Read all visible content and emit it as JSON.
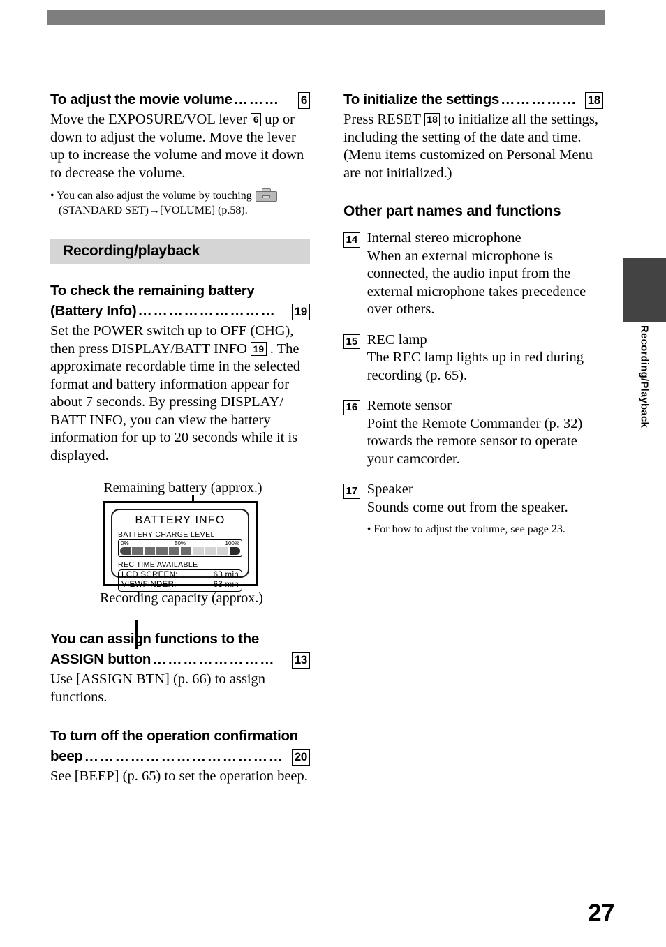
{
  "page": {
    "number": "27",
    "side_tab_label": "Recording/Playback",
    "accent_band_color": "#7e7e7e",
    "side_tab_color": "#434343",
    "section_band_color": "#d5d5d5"
  },
  "left_column": {
    "movie_volume": {
      "heading_text": "To adjust the movie volume",
      "heading_dots": "………",
      "heading_ref": "6",
      "body_line_1": "Move the EXPOSURE/VOL lever",
      "body_ref": "6",
      "body_line_2": "up or down to adjust the volume. Move the lever up to increase the volume and move it down to decrease the volume.",
      "bullet_prefix": "• You can also adjust the volume by touching",
      "bullet_icon": "setup-toolbox-icon",
      "bullet_suffix": "(STANDARD SET)→[VOLUME] (p.58)."
    },
    "section_band": "Recording/playback",
    "battery_check": {
      "heading_line_1": "To check the remaining battery",
      "heading_line_2": "(Battery Info)",
      "heading_dots": "………………………",
      "heading_ref": "19",
      "body_part_1": "Set the POWER switch up to OFF (CHG), then press DISPLAY/BATT INFO",
      "body_ref": "19",
      "body_part_2": ". The approximate recordable time in the selected format and battery information appear for about 7 seconds. By pressing DISPLAY/ BATT INFO, you can view the battery information for up to 20 seconds while it is displayed."
    },
    "figure": {
      "caption_top": "Remaining battery (approx.)",
      "caption_bottom": "Recording capacity (approx.)",
      "screen": {
        "title": "BATTERY INFO",
        "charge_level_label": "BATTERY CHARGE LEVEL",
        "scale_min": "0%",
        "scale_mid": "50%",
        "scale_max": "100%",
        "segments_total": 10,
        "segments_filled": 6,
        "rec_time_label": "REC TIME AVAILABLE",
        "rows": [
          {
            "label": "LCD SCREEN:",
            "value": "63 min"
          },
          {
            "label": "VIEWFINDER:",
            "value": "63 min"
          }
        ]
      }
    },
    "assign_button": {
      "heading_line_1": "You can assign functions to the",
      "heading_line_2": "ASSIGN button",
      "heading_dots": "……………………",
      "heading_ref": "13",
      "body": "Use [ASSIGN BTN] (p. 66) to assign functions."
    },
    "beep": {
      "heading_line_1": "To turn off the operation confirmation",
      "heading_line_2": "beep",
      "heading_dots": "…………………………………",
      "heading_ref": "20",
      "body": "See [BEEP] (p. 65) to set the operation beep."
    }
  },
  "right_column": {
    "initialize": {
      "heading_text": "To initialize the settings",
      "heading_dots": "……………",
      "heading_ref": "18",
      "body_part_1": "Press RESET",
      "body_ref": "18",
      "body_part_2": "to initialize all the settings, including the setting of the date and time.",
      "body_part_3": "(Menu items customized on Personal Menu are not initialized.)"
    },
    "other_parts_heading": "Other part names and functions",
    "parts": [
      {
        "num": "14",
        "title": "Internal stereo microphone",
        "desc": "When an external microphone is connected, the audio input from the external microphone takes precedence over others."
      },
      {
        "num": "15",
        "title": "REC lamp",
        "desc": "The REC lamp lights up in red during recording (p. 65)."
      },
      {
        "num": "16",
        "title": "Remote sensor",
        "desc": "Point the Remote Commander (p. 32) towards the remote sensor to operate your camcorder."
      },
      {
        "num": "17",
        "title": "Speaker",
        "desc": "Sounds come out from the speaker.",
        "bullet": "• For how to adjust the volume, see page 23."
      }
    ]
  }
}
